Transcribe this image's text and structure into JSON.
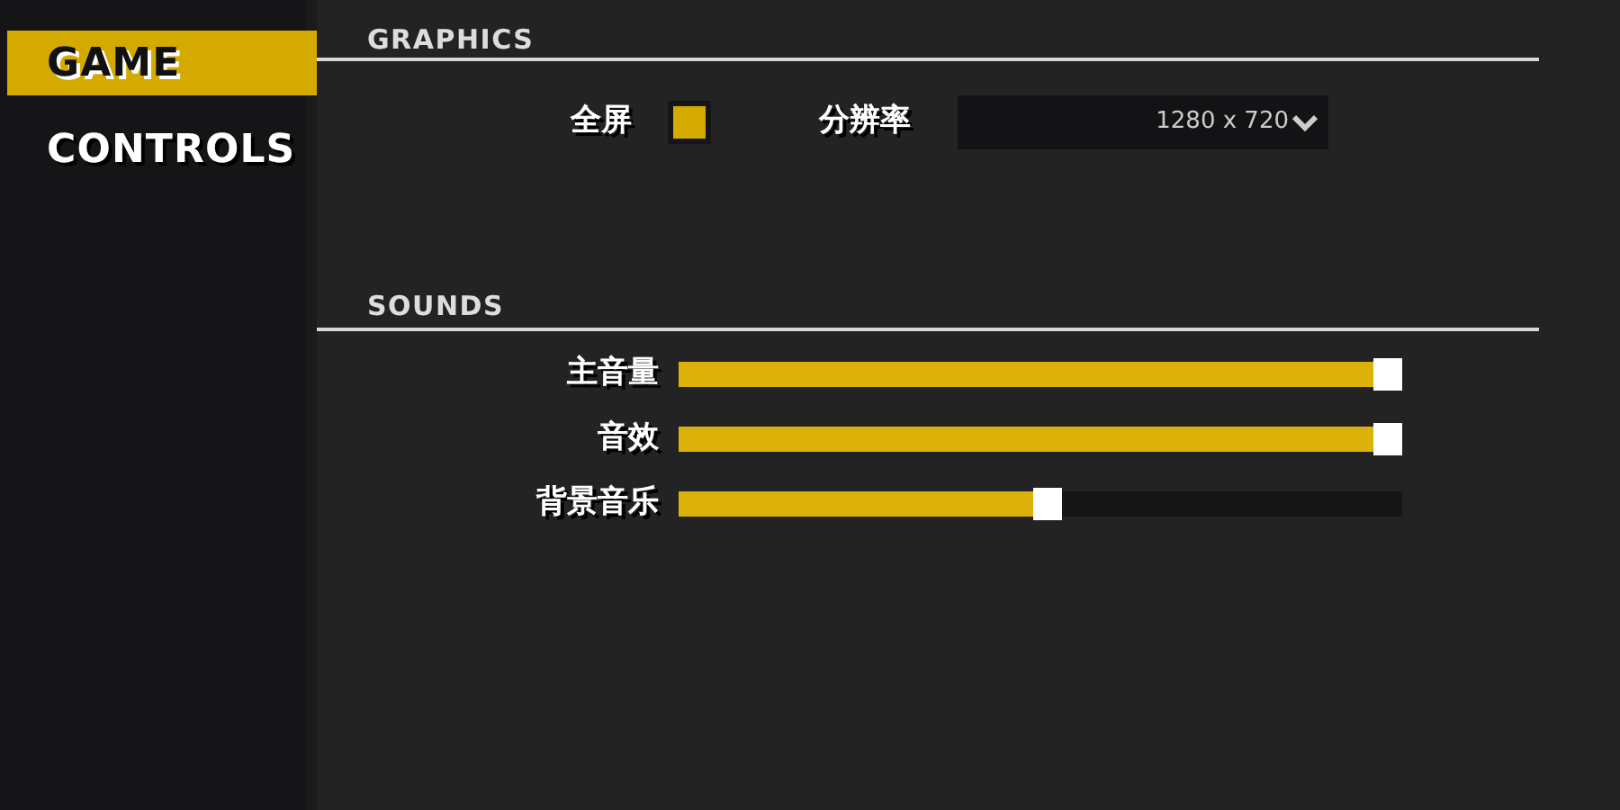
{
  "sidebar": {
    "items": [
      {
        "label": "GAME",
        "selected": true
      },
      {
        "label": "CONTROLS",
        "selected": false
      }
    ]
  },
  "graphics": {
    "heading": "GRAPHICS",
    "fullscreen": {
      "label": "全屏",
      "checked": true
    },
    "resolution": {
      "label": "分辨率",
      "value": "1280 x 720"
    }
  },
  "sounds": {
    "heading": "SOUNDS",
    "sliders": [
      {
        "label": "主音量",
        "level": 1.0
      },
      {
        "label": "音效",
        "level": 1.0
      },
      {
        "label": "背景音乐",
        "level": 0.53
      }
    ]
  }
}
